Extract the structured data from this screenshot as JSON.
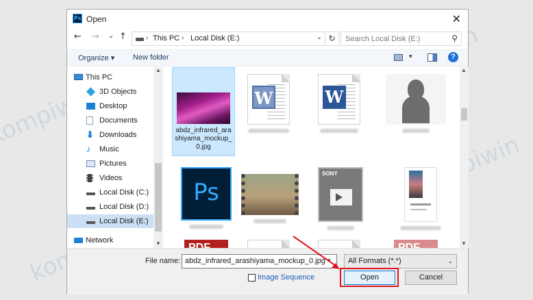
{
  "dialog": {
    "app_badge": "Ps",
    "title": "Open",
    "close_glyph": "✕"
  },
  "nav": {
    "back_glyph": "←",
    "forward_glyph": "→",
    "recent_glyph": "⌄",
    "up_glyph": "↑",
    "breadcrumb": [
      "This PC",
      "Local Disk (E:)"
    ],
    "breadcrumb_sep": "›",
    "refresh_glyph": "↻",
    "search_placeholder": "Search Local Disk (E:)",
    "search_glyph": "⚲"
  },
  "toolbar": {
    "organize": "Organize ▾",
    "new_folder": "New folder",
    "view_drop": "▾",
    "help": "?"
  },
  "sidebar": {
    "items": [
      {
        "label": "This PC",
        "icon": "pc-icon",
        "color": "#3b8ad9",
        "selected": false,
        "child": false
      },
      {
        "label": "3D Objects",
        "icon": "cube-icon",
        "color": "#29a3e0",
        "selected": false,
        "child": true
      },
      {
        "label": "Desktop",
        "icon": "desktop-icon",
        "color": "#1f7fd6",
        "selected": false,
        "child": true
      },
      {
        "label": "Documents",
        "icon": "documents-icon",
        "color": "#8aa2b8",
        "selected": false,
        "child": true
      },
      {
        "label": "Downloads",
        "icon": "download-icon",
        "color": "#1f7fd6",
        "selected": false,
        "child": true
      },
      {
        "label": "Music",
        "icon": "music-icon",
        "color": "#1f7fd6",
        "selected": false,
        "child": true
      },
      {
        "label": "Pictures",
        "icon": "pictures-icon",
        "color": "#6b8bb0",
        "selected": false,
        "child": true
      },
      {
        "label": "Videos",
        "icon": "videos-icon",
        "color": "#444444",
        "selected": false,
        "child": true
      },
      {
        "label": "Local Disk (C:)",
        "icon": "drive-icon",
        "color": "#555555",
        "selected": false,
        "child": true
      },
      {
        "label": "Local Disk (D:)",
        "icon": "drive-icon",
        "color": "#555555",
        "selected": false,
        "child": true
      },
      {
        "label": "Local Disk (E:)",
        "icon": "drive-icon",
        "color": "#555555",
        "selected": true,
        "child": true
      },
      {
        "label": "Network",
        "icon": "network-icon",
        "color": "#1f7fd6",
        "selected": false,
        "child": false
      }
    ]
  },
  "files": {
    "selected_name": "abdz_infrared_arashiyama_mockup_0.jpg",
    "word_letter": "W",
    "ps_letters": "Ps",
    "sony_label": "SONY",
    "pdf_label": "PDF"
  },
  "bottom": {
    "filename_label": "File name:",
    "filename_value": "abdz_infrared_arashiyama_mockup_0.jpg",
    "format_value": "All Formats (*.*)",
    "image_sequence_label": "Image Sequence",
    "open_label": "Open",
    "cancel_label": "Cancel"
  },
  "colors": {
    "accent_red": "#e0141b",
    "selection_blue": "#cce8ff",
    "photoshop_blue": "#31a8ff"
  },
  "watermark": "kompiwin"
}
